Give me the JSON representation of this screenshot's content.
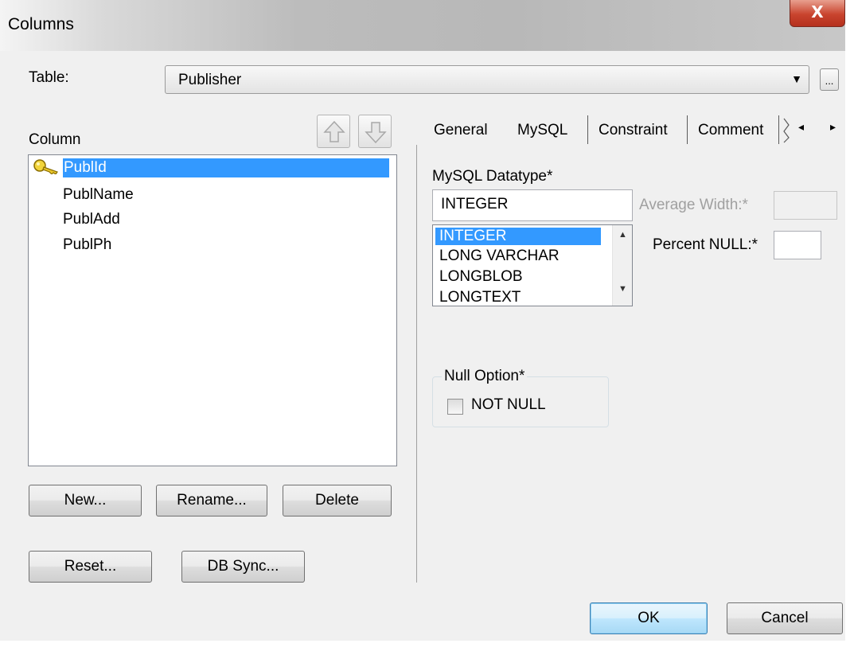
{
  "window": {
    "title": "Columns",
    "close_glyph": "X"
  },
  "table": {
    "label": "Table:",
    "value": "Publisher",
    "dropdown_icon": "▼",
    "browse_label": "..."
  },
  "column_list": {
    "label": "Column",
    "items": [
      {
        "name": "PublId",
        "is_key": true,
        "selected": true
      },
      {
        "name": "PublName",
        "is_key": false,
        "selected": false
      },
      {
        "name": "PublAdd",
        "is_key": false,
        "selected": false
      },
      {
        "name": "PublPh",
        "is_key": false,
        "selected": false
      }
    ]
  },
  "buttons": {
    "new": "New...",
    "rename": "Rename...",
    "delete": "Delete",
    "reset": "Reset...",
    "db_sync": "DB Sync...",
    "ok": "OK",
    "cancel": "Cancel"
  },
  "tabs": {
    "items": [
      "General",
      "MySQL",
      "Constraint",
      "Comment"
    ],
    "active": "MySQL",
    "scroll_left": "◂",
    "scroll_right": "▸"
  },
  "mysql": {
    "datatype_label": "MySQL Datatype*",
    "datatype_value": "INTEGER",
    "datatype_options": [
      "INTEGER",
      "LONG VARCHAR",
      "LONGBLOB",
      "LONGTEXT"
    ],
    "selected_option": "INTEGER",
    "average_width_label": "Average Width:*",
    "average_width_value": "",
    "percent_null_label": "Percent NULL:*",
    "percent_null_value": "",
    "null_option_label": "Null Option*",
    "not_null_label": "NOT NULL",
    "not_null_checked": false
  },
  "colors": {
    "selection": "#3399ff",
    "dialog_bg": "#f0f0f0",
    "close_red": "#c9442e"
  }
}
